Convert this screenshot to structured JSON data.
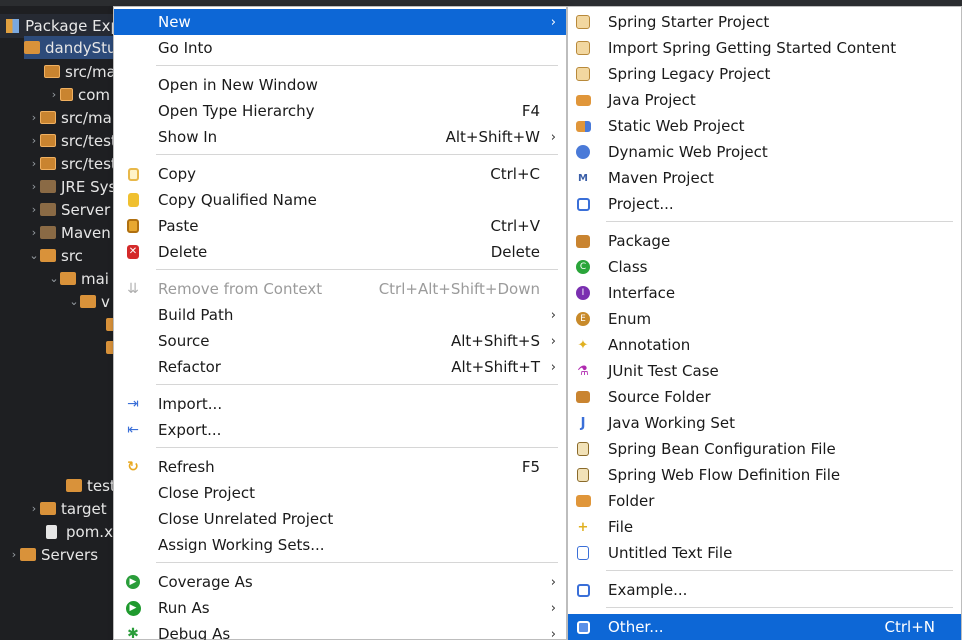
{
  "explorer": {
    "title": "Package Exp",
    "items": [
      {
        "label": "dandyStu",
        "indent": 0
      },
      {
        "label": "src/ma",
        "indent": 1
      },
      {
        "label": "com",
        "indent": 2
      },
      {
        "label": "src/ma",
        "indent": 1
      },
      {
        "label": "src/test",
        "indent": 1
      },
      {
        "label": "src/test",
        "indent": 1
      },
      {
        "label": "JRE Sys",
        "indent": 1
      },
      {
        "label": "Server",
        "indent": 1
      },
      {
        "label": "Maven",
        "indent": 1
      },
      {
        "label": "src",
        "indent": 1
      },
      {
        "label": "mai",
        "indent": 2
      },
      {
        "label": "v",
        "indent": 3
      },
      {
        "label": "test",
        "indent": 2
      },
      {
        "label": "target",
        "indent": 1
      },
      {
        "label": "pom.xm",
        "indent": 1
      },
      {
        "label": "Servers",
        "indent": 0
      }
    ]
  },
  "menu": {
    "items": [
      {
        "label": "New",
        "shortcut": "",
        "arrow": true
      },
      {
        "label": "Go Into",
        "shortcut": ""
      },
      {
        "label": "Open in New Window",
        "shortcut": ""
      },
      {
        "label": "Open Type Hierarchy",
        "shortcut": "F4"
      },
      {
        "label": "Show In",
        "shortcut": "Alt+Shift+W",
        "arrow": true
      },
      {
        "label": "Copy",
        "shortcut": "Ctrl+C"
      },
      {
        "label": "Copy Qualified Name",
        "shortcut": ""
      },
      {
        "label": "Paste",
        "shortcut": "Ctrl+V"
      },
      {
        "label": "Delete",
        "shortcut": "Delete"
      },
      {
        "label": "Remove from Context",
        "shortcut": "Ctrl+Alt+Shift+Down"
      },
      {
        "label": "Build Path",
        "shortcut": "",
        "arrow": true
      },
      {
        "label": "Source",
        "shortcut": "Alt+Shift+S",
        "arrow": true
      },
      {
        "label": "Refactor",
        "shortcut": "Alt+Shift+T",
        "arrow": true
      },
      {
        "label": "Import...",
        "shortcut": ""
      },
      {
        "label": "Export...",
        "shortcut": ""
      },
      {
        "label": "Refresh",
        "shortcut": "F5"
      },
      {
        "label": "Close Project",
        "shortcut": ""
      },
      {
        "label": "Close Unrelated Project",
        "shortcut": ""
      },
      {
        "label": "Assign Working Sets...",
        "shortcut": ""
      },
      {
        "label": "Coverage As",
        "shortcut": "",
        "arrow": true
      },
      {
        "label": "Run As",
        "shortcut": "",
        "arrow": true
      },
      {
        "label": "Debug As",
        "shortcut": "",
        "arrow": true
      }
    ]
  },
  "submenu": {
    "items": [
      {
        "label": "Spring Starter Project",
        "shortcut": ""
      },
      {
        "label": "Import Spring Getting Started Content",
        "shortcut": ""
      },
      {
        "label": "Spring Legacy Project",
        "shortcut": ""
      },
      {
        "label": "Java Project",
        "shortcut": ""
      },
      {
        "label": "Static Web Project",
        "shortcut": ""
      },
      {
        "label": "Dynamic Web Project",
        "shortcut": ""
      },
      {
        "label": "Maven Project",
        "shortcut": ""
      },
      {
        "label": "Project...",
        "shortcut": ""
      },
      {
        "label": "Package",
        "shortcut": ""
      },
      {
        "label": "Class",
        "shortcut": ""
      },
      {
        "label": "Interface",
        "shortcut": ""
      },
      {
        "label": "Enum",
        "shortcut": ""
      },
      {
        "label": "Annotation",
        "shortcut": ""
      },
      {
        "label": "JUnit Test Case",
        "shortcut": ""
      },
      {
        "label": "Source Folder",
        "shortcut": ""
      },
      {
        "label": "Java Working Set",
        "shortcut": ""
      },
      {
        "label": "Spring Bean Configuration File",
        "shortcut": ""
      },
      {
        "label": "Spring Web Flow Definition File",
        "shortcut": ""
      },
      {
        "label": "Folder",
        "shortcut": ""
      },
      {
        "label": "File",
        "shortcut": ""
      },
      {
        "label": "Untitled Text File",
        "shortcut": ""
      },
      {
        "label": "Example...",
        "shortcut": ""
      },
      {
        "label": "Other...",
        "shortcut": "Ctrl+N"
      }
    ]
  },
  "colors": {
    "highlight": "#0d67d6",
    "menu_bg": "#ffffff",
    "ide_bg": "#1e1f22"
  }
}
